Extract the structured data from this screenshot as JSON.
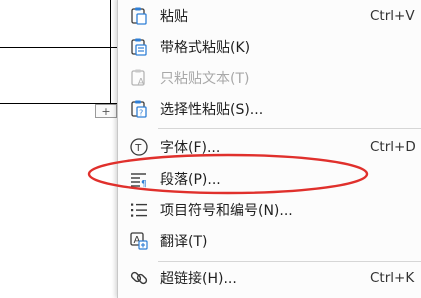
{
  "handle": {
    "icon": "plus-icon",
    "glyph": "+"
  },
  "menu": {
    "items": [
      {
        "id": "paste",
        "label": "粘贴",
        "shortcut": "Ctrl+V",
        "icon": "paste-icon",
        "enabled": true
      },
      {
        "id": "paste-keep-format",
        "label": "带格式粘贴(K)",
        "shortcut": "",
        "icon": "paste-format-icon",
        "enabled": true
      },
      {
        "id": "paste-text-only",
        "label": "只粘贴文本(T)",
        "shortcut": "",
        "icon": "paste-text-icon",
        "enabled": false
      },
      {
        "id": "paste-special",
        "label": "选择性粘贴(S)...",
        "shortcut": "",
        "icon": "paste-special-icon",
        "enabled": true
      },
      {
        "id": "font",
        "label": "字体(F)...",
        "shortcut": "Ctrl+D",
        "icon": "font-icon",
        "enabled": true
      },
      {
        "id": "paragraph",
        "label": "段落(P)...",
        "shortcut": "",
        "icon": "paragraph-icon",
        "enabled": true
      },
      {
        "id": "bullets-numbering",
        "label": "项目符号和编号(N)...",
        "shortcut": "",
        "icon": "list-icon",
        "enabled": true
      },
      {
        "id": "translate",
        "label": "翻译(T)",
        "shortcut": "",
        "icon": "translate-icon",
        "enabled": true
      },
      {
        "id": "hyperlink",
        "label": "超链接(H)...",
        "shortcut": "Ctrl+K",
        "icon": "link-icon",
        "enabled": true
      }
    ]
  },
  "highlight": {
    "target": "paragraph",
    "color": "#e0302c"
  }
}
